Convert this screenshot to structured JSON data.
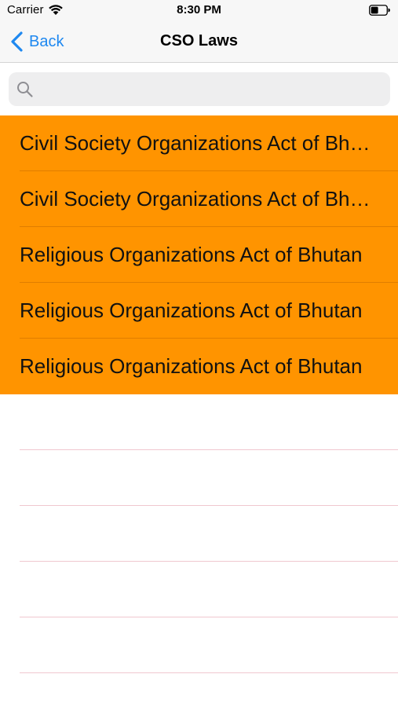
{
  "status_bar": {
    "carrier": "Carrier",
    "time": "8:30 PM",
    "wifi_icon": "wifi-icon",
    "battery_icon": "battery-icon"
  },
  "nav": {
    "back_label": "Back",
    "back_icon": "chevron-left-icon",
    "title": "CSO Laws"
  },
  "search": {
    "placeholder": "",
    "value": "",
    "icon": "search-icon"
  },
  "list": {
    "items": [
      {
        "label": "Civil Society Organizations Act of Bhutan"
      },
      {
        "label": "Civil Society Organizations Act of Bhutan"
      },
      {
        "label": "Religious Organizations Act of Bhutan"
      },
      {
        "label": "Religious Organizations Act of Bhutan"
      },
      {
        "label": "Religious Organizations Act of Bhutan"
      }
    ]
  },
  "colors": {
    "accent_blue": "#1e88f0",
    "row_orange": "#ff9400",
    "bar_background": "#f7f7f7",
    "search_background": "#eeeeef"
  }
}
